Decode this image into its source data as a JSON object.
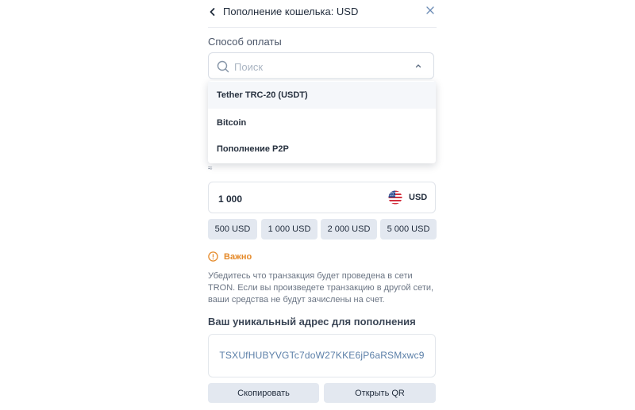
{
  "header": {
    "title": "Пополнение кошелька: USD"
  },
  "payment": {
    "label": "Способ оплаты",
    "search_placeholder": "Поиск",
    "options": [
      "Tether TRC-20 (USDT)",
      "Bitcoin",
      "Пополнение P2P"
    ]
  },
  "amount": {
    "approx": "≈",
    "value": "1 000",
    "currency": "USD",
    "presets": [
      "500 USD",
      "1 000 USD",
      "2 000 USD",
      "5 000 USD"
    ]
  },
  "warning": {
    "title": "Важно",
    "text": "Убедитесь что транзакция будет проведена в сети TRON. Если вы произведете транзакцию в другой сети, ваши средства не будут зачислены на счет.",
    "color": "#e58a2a"
  },
  "address": {
    "label": "Ваш уникальный адрес для пополнения",
    "value": "TSXUfHUBYVGTc7doW27KKE6jP6aRSMxwc9"
  },
  "actions": {
    "copy": "Скопировать",
    "qr": "Открыть QR"
  },
  "icons": [
    "chevron-left-icon",
    "close-icon",
    "search-icon",
    "chevron-up-icon",
    "us-flag-icon",
    "info-icon"
  ]
}
